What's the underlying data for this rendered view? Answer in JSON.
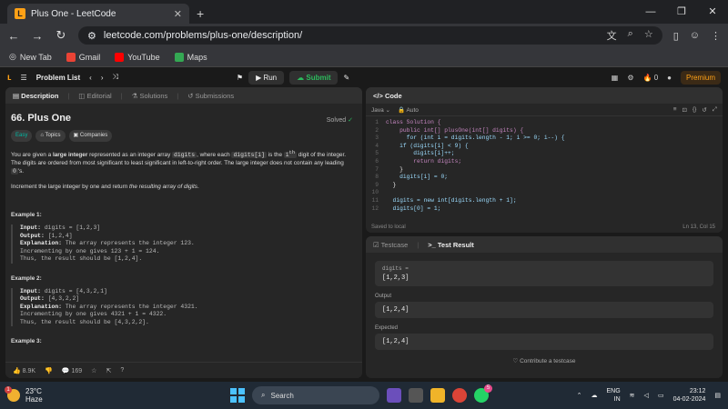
{
  "browser": {
    "tab_title": "Plus One - LeetCode",
    "url": "leetcode.com/problems/plus-one/description/",
    "bookmarks": [
      "New Tab",
      "Gmail",
      "YouTube",
      "Maps"
    ]
  },
  "lc_nav": {
    "problem_list": "Problem List",
    "run": "Run",
    "submit": "Submit",
    "streak": "0",
    "premium": "Premium"
  },
  "left_tabs": [
    "Description",
    "Editorial",
    "Solutions",
    "Submissions"
  ],
  "problem": {
    "title": "66. Plus One",
    "solved": "Solved",
    "difficulty": "Easy",
    "topics": "Topics",
    "companies": "Companies",
    "p1a": "You are given a ",
    "p1b": "large integer",
    "p1c": " represented as an integer array ",
    "p1d": "digits",
    "p1e": ", where each ",
    "p1f": "digits[i]",
    "p1g": " is the ",
    "p1h": "i",
    "p1h_sup": "th",
    "p1i": " digit of the integer. The digits are ordered from most significant to least significant in left-to-right order. The large integer does not contain any leading ",
    "p1j": "0",
    "p1k": "'s.",
    "p2a": "Increment the large integer by one and return ",
    "p2b": "the resulting array of digits",
    "p2c": ".",
    "ex1_title": "Example 1:",
    "ex1_input_label": "Input:",
    "ex1_input": " digits = [1,2,3]",
    "ex1_output_label": "Output:",
    "ex1_output": " [1,2,4]",
    "ex1_expl_label": "Explanation:",
    "ex1_expl1": " The array represents the integer 123.",
    "ex1_expl2": "Incrementing by one gives 123 + 1 = 124.",
    "ex1_expl3": "Thus, the result should be [1,2,4].",
    "ex2_title": "Example 2:",
    "ex2_input_label": "Input:",
    "ex2_input": " digits = [4,3,2,1]",
    "ex2_output_label": "Output:",
    "ex2_output": " [4,3,2,2]",
    "ex2_expl_label": "Explanation:",
    "ex2_expl1": " The array represents the integer 4321.",
    "ex2_expl2": "Incrementing by one gives 4321 + 1 = 4322.",
    "ex2_expl3": "Thus, the result should be [4,3,2,2].",
    "ex3_title": "Example 3:",
    "likes": "8.9K",
    "comments": "169"
  },
  "code_panel": {
    "title": "Code",
    "language": "Java",
    "mode": "Auto",
    "saved": "Saved to local",
    "cursor": "Ln 13, Col 15",
    "lines": [
      {
        "n": "1",
        "text": "class Solution {"
      },
      {
        "n": "2",
        "text": "    public int[] plusOne(int[] digits) {"
      },
      {
        "n": "3",
        "text": "      for (int i = digits.length - 1; i >= 0; i--) {"
      },
      {
        "n": "4",
        "text": "    if (digits[i] < 9) {"
      },
      {
        "n": "5",
        "text": "        digits[i]++;"
      },
      {
        "n": "6",
        "text": "        return digits;"
      },
      {
        "n": "7",
        "text": "    }"
      },
      {
        "n": "8",
        "text": "    digits[i] = 0;"
      },
      {
        "n": "9",
        "text": "  }"
      },
      {
        "n": "10",
        "text": ""
      },
      {
        "n": "11",
        "text": "  digits = new int[digits.length + 1];"
      },
      {
        "n": "12",
        "text": "  digits[0] = 1;"
      }
    ]
  },
  "test_panel": {
    "tab1": "Testcase",
    "tab2": "Test Result",
    "input_label": "digits =",
    "input_value": "[1,2,3]",
    "output_label": "Output",
    "output_value": "[1,2,4]",
    "expected_label": "Expected",
    "expected_value": "[1,2,4]",
    "contribute": "Contribute a testcase"
  },
  "taskbar": {
    "temp": "23°C",
    "weather": "Haze",
    "weather_badge": "1",
    "search": "Search",
    "chrome_badge": "5",
    "lang1": "ENG",
    "lang2": "IN",
    "time": "23:12",
    "date": "04-02-2024"
  }
}
